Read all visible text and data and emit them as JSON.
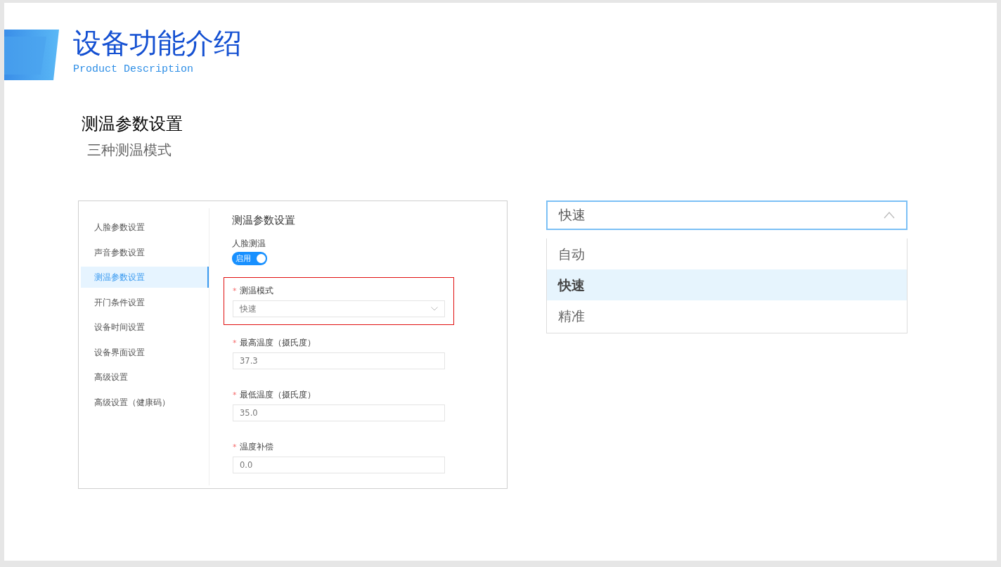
{
  "slide": {
    "title": "设备功能介绍",
    "subtitle": "Product Description"
  },
  "section": {
    "title": "测温参数设置",
    "subtitle": "三种测温模式"
  },
  "settings_window": {
    "sidebar": {
      "items": [
        {
          "label": "人脸参数设置",
          "selected": false
        },
        {
          "label": "声音参数设置",
          "selected": false
        },
        {
          "label": "测温参数设置",
          "selected": true
        },
        {
          "label": "开门条件设置",
          "selected": false
        },
        {
          "label": "设备时间设置",
          "selected": false
        },
        {
          "label": "设备界面设置",
          "selected": false
        },
        {
          "label": "高级设置",
          "selected": false
        },
        {
          "label": "高级设置（健康码）",
          "selected": false
        }
      ]
    },
    "form": {
      "title": "测温参数设置",
      "face_temp": {
        "label": "人脸测温",
        "toggle": {
          "label": "启用",
          "on": true
        }
      },
      "fields": [
        {
          "kind": "select",
          "label": "测温模式",
          "required_mark": "*",
          "value": "快速",
          "highlighted": true
        },
        {
          "kind": "input",
          "label": "最高温度（摄氏度）",
          "required_mark": "*",
          "value": "37.3",
          "highlighted": false
        },
        {
          "kind": "input",
          "label": "最低温度（摄氏度）",
          "required_mark": "*",
          "value": "35.0",
          "highlighted": false
        },
        {
          "kind": "input",
          "label": "温度补偿",
          "required_mark": "*",
          "value": "0.0",
          "highlighted": false
        }
      ]
    }
  },
  "dropdown": {
    "value": "快速",
    "expanded": true,
    "options": [
      {
        "label": "自动",
        "selected": false
      },
      {
        "label": "快速",
        "selected": true
      },
      {
        "label": "精准",
        "selected": false
      }
    ]
  }
}
